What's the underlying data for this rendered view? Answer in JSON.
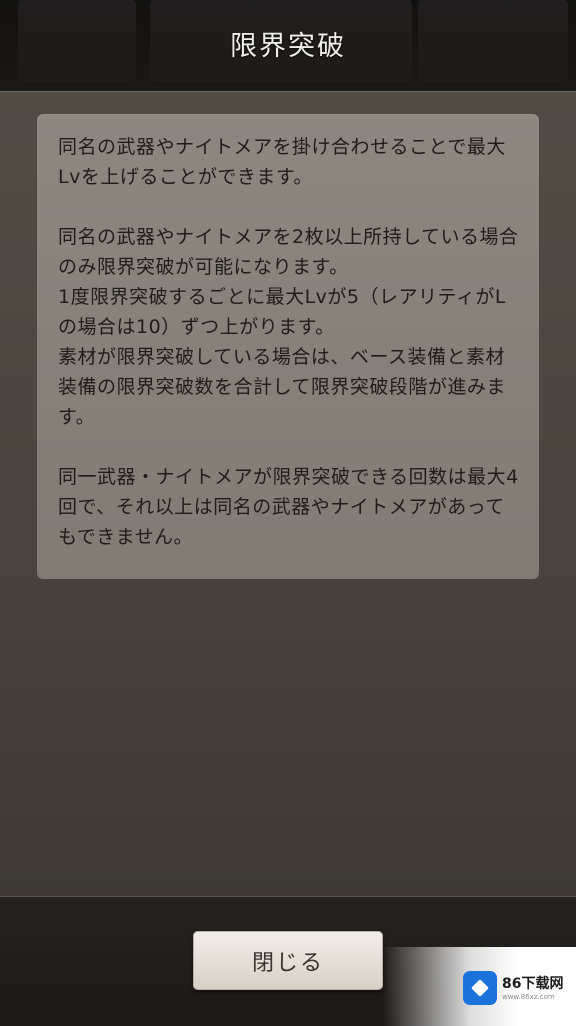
{
  "header": {
    "title": "限界突破"
  },
  "panel": {
    "paragraphs": [
      "同名の武器やナイトメアを掛け合わせることで最大Lvを上げることができます。",
      "同名の武器やナイトメアを2枚以上所持している場合のみ限界突破が可能になります。\n1度限界突破するごとに最大Lvが5（レアリティがLの場合は10）ずつ上がります。\n素材が限界突破している場合は、ベース装備と素材装備の限界突破数を合計して限界突破段階が進みます。",
      "同一武器・ナイトメアが限界突破できる回数は最大4回で、それ以上は同名の武器やナイトメアがあってもできません。"
    ]
  },
  "footer": {
    "close_label": "閉じる"
  },
  "watermark": {
    "text": "86下载网",
    "sub": "www.86xz.com"
  },
  "colors": {
    "panel_bg": "#8d8780",
    "text": "#201c18",
    "button_bg": "#f3efe9"
  },
  "icons": {
    "watermark_logo": "cube-icon"
  }
}
